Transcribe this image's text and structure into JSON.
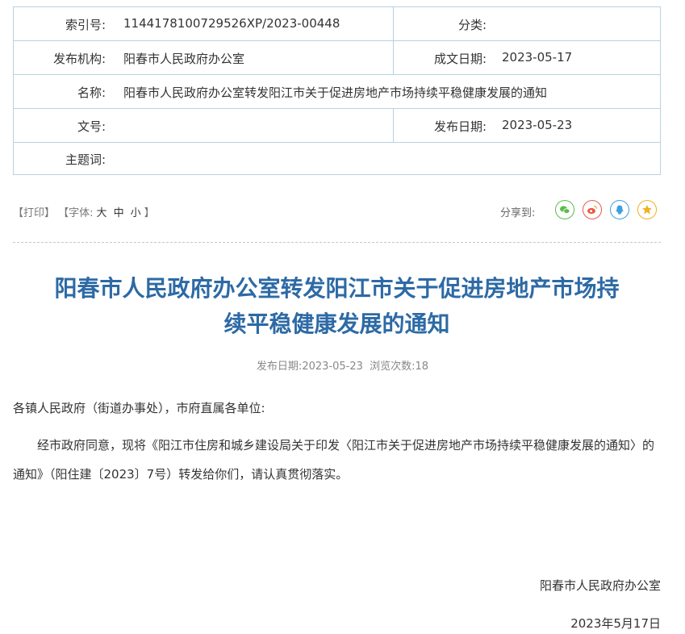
{
  "meta": {
    "index_label": "索引号:",
    "index_value": "1144178100729526XP/2023-00448",
    "category_label": "分类:",
    "category_value": "",
    "publisher_label": "发布机构:",
    "publisher_value": "阳春市人民政府办公室",
    "created_label": "成文日期:",
    "created_value": "2023-05-17",
    "name_label": "名称:",
    "name_value": "阳春市人民政府办公室转发阳江市关于促进房地产市场持续平稳健康发展的通知",
    "doc_no_label": "文号:",
    "doc_no_value": "",
    "publish_date_label": "发布日期:",
    "publish_date_value": "2023-05-23",
    "keywords_label": "主题词:",
    "keywords_value": ""
  },
  "toolbar": {
    "print": "【打印】",
    "font_prefix": "【字体:",
    "font_large": "大",
    "font_medium": "中",
    "font_small": "小",
    "font_suffix": "】",
    "share_label": "分享到:",
    "share_icons": [
      "wechat-icon",
      "weibo-icon",
      "qq-icon",
      "qzone-icon"
    ]
  },
  "article": {
    "title_line1": "阳春市人民政府办公室转发阳江市关于促进房地产市场持",
    "title_line2": "续平稳健康发展的通知",
    "publish_label": "发布日期:",
    "publish_date": "2023-05-23",
    "views_label": "浏览次数:",
    "views": "18",
    "salutation": "各镇人民政府（街道办事处），市府直属各单位:",
    "paragraph": "经市政府同意，现将《阳江市住房和城乡建设局关于印发〈阳江市关于促进房地产市场持续平稳健康发展的通知〉的通知》（阳住建〔2023〕7号）转发给你们，请认真贯彻落实。",
    "signature": "阳春市人民政府办公室",
    "sign_date": "2023年5月17日"
  },
  "colors": {
    "title": "#2d6aa5",
    "border": "#b9d1e3",
    "wechat": "#5bbd4a",
    "weibo": "#e8594a",
    "qq": "#3fa0e0",
    "qzone": "#f0b020"
  }
}
